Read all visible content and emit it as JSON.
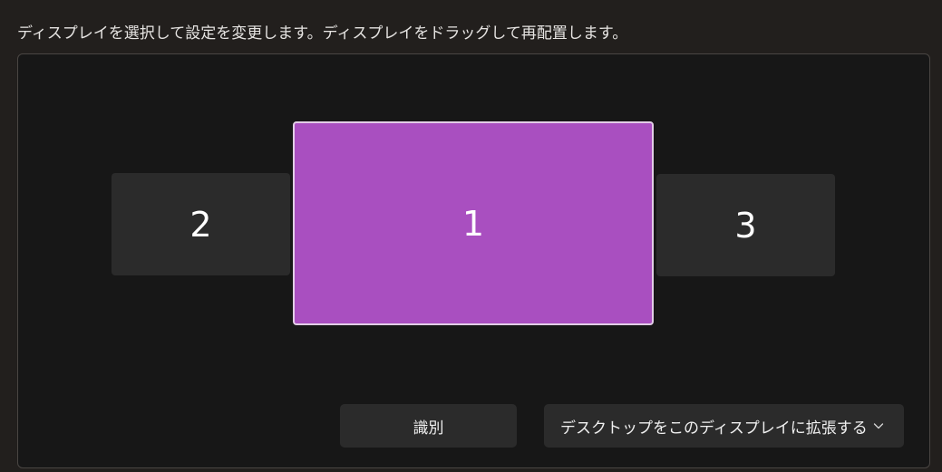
{
  "instruction_text": "ディスプレイを選択して設定を変更します。ディスプレイをドラッグして再配置します。",
  "colors": {
    "page_background": "#221f1d",
    "panel_background": "#171717",
    "selected_monitor": "#a94fc0",
    "monitor": "#2b2b2b",
    "button": "#2b2b2b"
  },
  "monitors": [
    {
      "label": "2",
      "selected": false
    },
    {
      "label": "1",
      "selected": true
    },
    {
      "label": "3",
      "selected": false
    }
  ],
  "identify_button": {
    "label": "識別"
  },
  "mode_select": {
    "value": "デスクトップをこのディスプレイに拡張する",
    "icon": "chevron-down-icon"
  }
}
